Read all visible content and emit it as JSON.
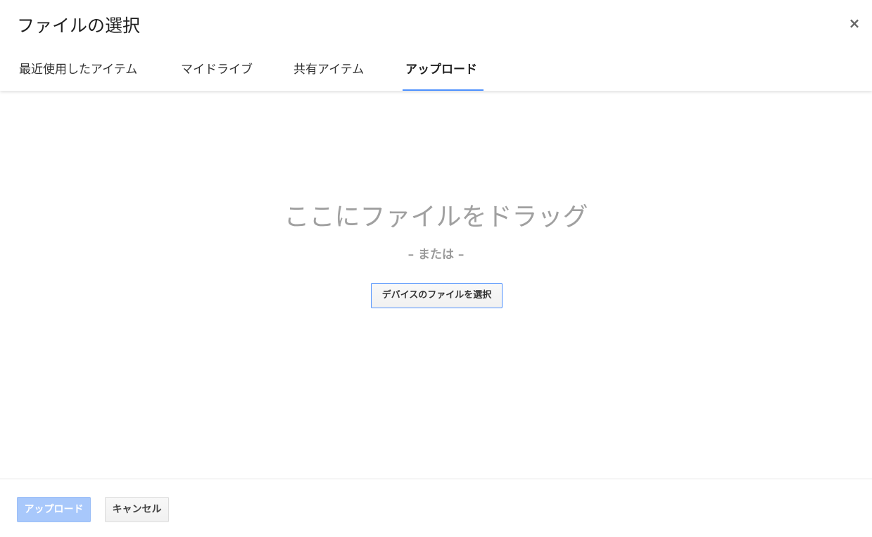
{
  "dialog": {
    "title": "ファイルの選択",
    "close_label": "×"
  },
  "tabs": [
    {
      "label": "最近使用したアイテム",
      "active": false
    },
    {
      "label": "マイドライブ",
      "active": false
    },
    {
      "label": "共有アイテム",
      "active": false
    },
    {
      "label": "アップロード",
      "active": true
    }
  ],
  "upload": {
    "drag_text": "ここにファイルをドラッグ",
    "or_text": "– または –",
    "select_button_label": "デバイスのファイルを選択"
  },
  "footer": {
    "upload_label": "アップロード",
    "upload_enabled": false,
    "cancel_label": "キャンセル"
  },
  "colors": {
    "accent": "#4d90fe",
    "upload_button_disabled": "#a8c8fb",
    "drag_text": "#a0a0a0"
  }
}
